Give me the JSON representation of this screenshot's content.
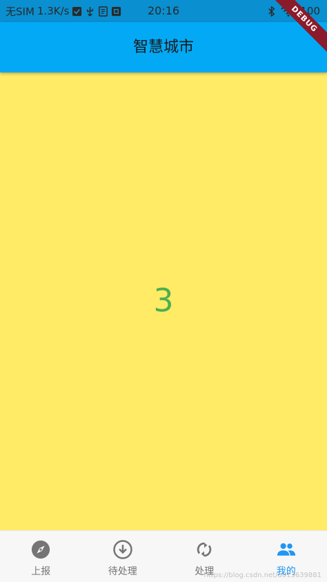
{
  "status_bar": {
    "carrier": "无SIM",
    "speed": "1.3K/s",
    "time": "20:16",
    "battery": "100"
  },
  "app_bar": {
    "title": "智慧城市"
  },
  "debug_label": "DEBUG",
  "content": {
    "value": "3",
    "background": "#ffeb66",
    "value_color": "#4caf50"
  },
  "bottom_nav": {
    "items": [
      {
        "label": "上报",
        "icon": "compass-icon"
      },
      {
        "label": "待处理",
        "icon": "download-circle-icon"
      },
      {
        "label": "处理",
        "icon": "sync-icon"
      },
      {
        "label": "我的",
        "icon": "people-icon"
      }
    ],
    "active_index": 3,
    "active_color": "#2196f3"
  },
  "watermark": "https://blog.csdn.net/u013639881"
}
